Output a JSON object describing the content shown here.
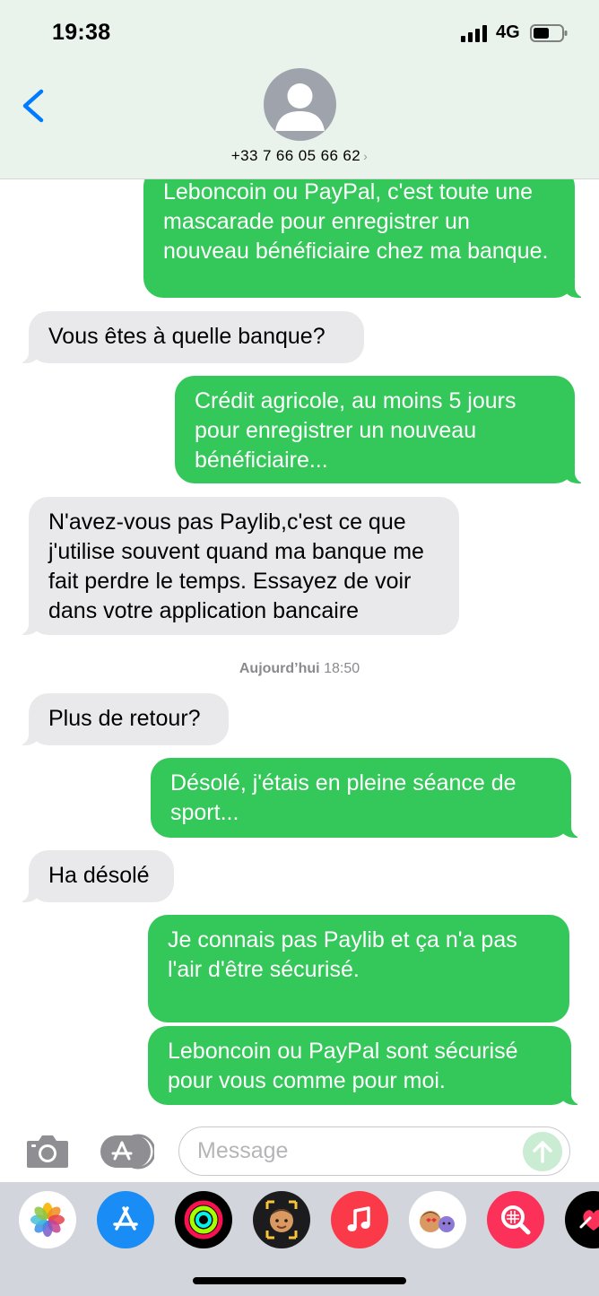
{
  "status_bar": {
    "time": "19:38",
    "network": "4G"
  },
  "header": {
    "contact": "+33 7 66 05 66 62",
    "chevron": "›"
  },
  "messages": [
    {
      "direction": "out",
      "text": "Leboncoin ou PayPal, c'est toute une mascarade pour enregistrer un nouveau bénéficiaire chez ma banque."
    },
    {
      "direction": "in",
      "text": "Vous êtes à quelle banque?"
    },
    {
      "direction": "out",
      "text": "Crédit agricole, au moins 5 jours pour enregistrer un nouveau bénéficiaire..."
    },
    {
      "direction": "in",
      "text": "N'avez-vous pas Paylib,c'est ce que j'utilise souvent quand ma banque me fait perdre le temps. Essayez de voir dans votre application bancaire"
    },
    {
      "direction": "in",
      "text": "Plus de retour?"
    },
    {
      "direction": "out",
      "text": "Désolé, j'étais en pleine séance de sport..."
    },
    {
      "direction": "in",
      "text": "Ha désolé"
    },
    {
      "direction": "out",
      "text": "Je connais pas Paylib et ça n'a pas l'air d'être sécurisé."
    },
    {
      "direction": "out",
      "text": "Leboncoin ou PayPal sont sécurisé pour vous comme pour moi."
    }
  ],
  "timestamp": {
    "day": "Aujourd’hui",
    "time": "18:50"
  },
  "input": {
    "placeholder": "Message"
  },
  "app_drawer": [
    "photos-icon",
    "app-store-icon",
    "fitness-icon",
    "memoji-icon",
    "music-icon",
    "memoji-stickers-icon",
    "search-images-icon",
    "digital-touch-icon"
  ],
  "colors": {
    "outgoing": "#34c759",
    "incoming": "#e9e9eb",
    "header": "#e9f2eb",
    "link_blue": "#007aff"
  }
}
